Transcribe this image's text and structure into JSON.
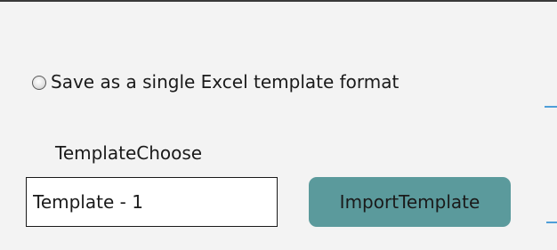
{
  "export_options": {
    "single_template_option": {
      "label": "Save as a single Excel template format",
      "selected": false
    }
  },
  "template_section": {
    "label": "TemplateChoose",
    "input_value": "Template - 1",
    "import_button_label": "ImportTemplate"
  },
  "colors": {
    "panel_background": "#f3f3f3",
    "button_accent": "#5b9a9c",
    "connector_line": "#4f9fd8"
  }
}
